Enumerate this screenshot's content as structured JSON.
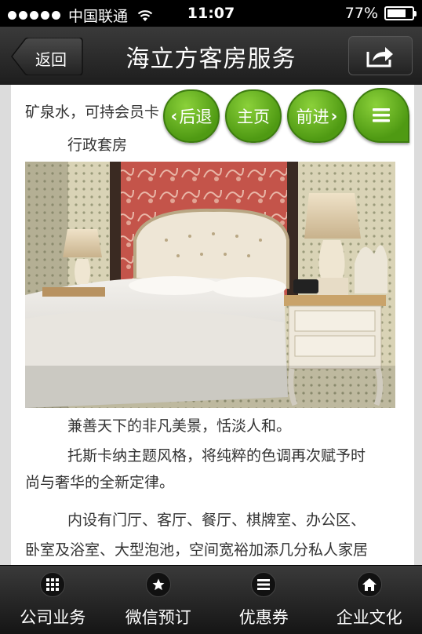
{
  "status_bar": {
    "carrier": "中国联通",
    "time": "11:07",
    "battery_percent": "77%",
    "battery_level": 0.77
  },
  "nav": {
    "back_label": "返回",
    "title": "海立方客房服务",
    "share_icon": "share-icon"
  },
  "floating_nav": {
    "back_label": "后退",
    "home_label": "主页",
    "forward_label": "前进",
    "menu_icon": "menu-icon"
  },
  "article": {
    "line_partial": "矿泉水，可持会员卡",
    "heading": "行政套房",
    "image_name": "executive-suite-photo",
    "paragraphs": [
      [
        "兼善天下的非凡美景，恬淡人和。"
      ],
      [
        "托斯卡纳主题风格，将纯粹的色调再次赋予时",
        "尚与奢华的全新定律。"
      ],
      [
        "内设有门厅、客厅、餐厅、棋牌室、办公区、",
        "卧室及浴室、大型泡池，空间宽裕加添几分私人家居"
      ]
    ]
  },
  "tabbar": {
    "items": [
      {
        "label": "公司业务",
        "icon": "grid-icon"
      },
      {
        "label": "微信预订",
        "icon": "star-icon"
      },
      {
        "label": "优惠券",
        "icon": "list-icon"
      },
      {
        "label": "企业文化",
        "icon": "home-icon"
      }
    ]
  },
  "colors": {
    "fab_green": "#5aa81a",
    "bar_dark": "#2a2a2a"
  }
}
